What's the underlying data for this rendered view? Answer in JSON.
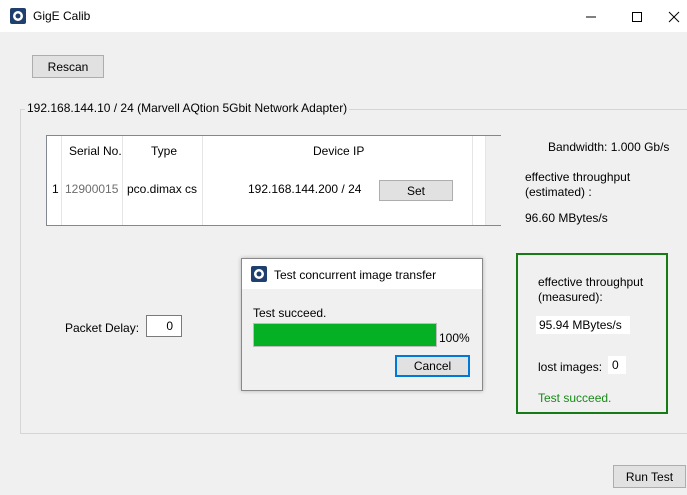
{
  "window": {
    "title": "GigE Calib",
    "minimize_icon": "minimize-icon",
    "maximize_icon": "maximize-icon",
    "close_icon": "close-icon"
  },
  "toolbar": {
    "rescan_label": "Rescan"
  },
  "adapter": {
    "label": "192.168.144.10 / 24 (Marvell AQtion 5Gbit Network Adapter)"
  },
  "table": {
    "headers": {
      "serial": "Serial No.",
      "type": "Type",
      "ip": "Device IP"
    },
    "rows": [
      {
        "index": "1",
        "serial": "12900015",
        "type": "pco.dimax cs",
        "ip": "192.168.144.200 / 24",
        "set_label": "Set"
      }
    ]
  },
  "info": {
    "bandwidth": "Bandwidth: 1.000 Gb/s",
    "estimated_label": "effective throughput (estimated) :",
    "estimated_value": "96.60 MBytes/s"
  },
  "packet_delay": {
    "label": "Packet Delay:",
    "value": "0"
  },
  "dialog": {
    "title": "Test concurrent image transfer",
    "message": "Test succeed.",
    "progress": 100,
    "progress_text": "100%",
    "cancel_label": "Cancel"
  },
  "measured": {
    "label": "effective throughput (measured):",
    "value": "95.94 MBytes/s",
    "lost_label": "lost images:",
    "lost_value": "0",
    "status": "Test succeed.",
    "status_color": "#1a8a1a",
    "border_color": "#167a16"
  },
  "run_test_label": "Run Test",
  "colors": {
    "progress_fill": "#06b025",
    "accent": "#0078d7"
  }
}
